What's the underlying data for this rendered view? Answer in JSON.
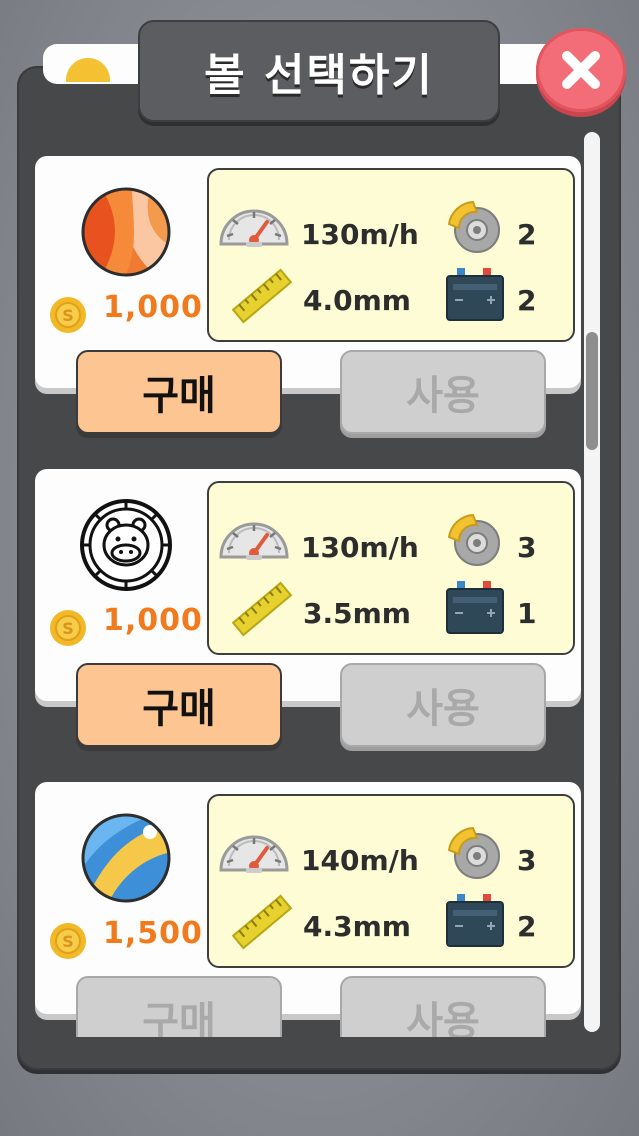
{
  "title": "볼 선택하기",
  "close_icon": "close-x-icon",
  "colors": {
    "panel": "#47484a",
    "price": "#f07a1c",
    "stats_bg": "#fdfcd5",
    "buy_button": "#fcc591",
    "disabled_button": "#cfcfcf",
    "close_button": "#f26d78"
  },
  "balls": [
    {
      "icon": "beach-ball-orange-icon",
      "price": "1,000",
      "speed": "130m/h",
      "size": "4.0mm",
      "brake": "2",
      "battery": "2",
      "buy_label": "구매",
      "use_label": "사용",
      "buy_enabled": true,
      "use_enabled": false
    },
    {
      "icon": "hippo-ball-icon",
      "price": "1,000",
      "speed": "130m/h",
      "size": "3.5mm",
      "brake": "3",
      "battery": "1",
      "buy_label": "구매",
      "use_label": "사용",
      "buy_enabled": true,
      "use_enabled": false
    },
    {
      "icon": "beach-ball-blue-icon",
      "price": "1,500",
      "speed": "140m/h",
      "size": "4.3mm",
      "brake": "3",
      "battery": "2",
      "buy_label": "구매",
      "use_label": "사용",
      "buy_enabled": false,
      "use_enabled": false
    }
  ]
}
